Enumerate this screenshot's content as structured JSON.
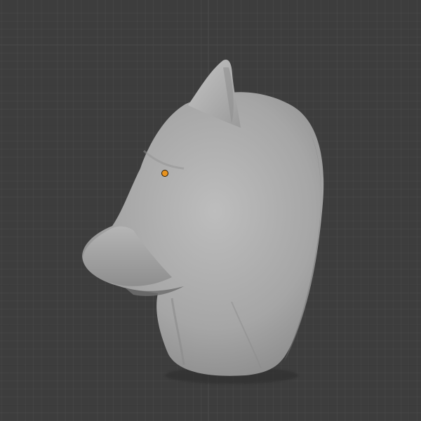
{
  "viewport": {
    "mode": "3D Viewport",
    "background_color": "#3d3d3d",
    "grid_color": "#474747"
  },
  "object": {
    "shape": "sculpted animal head mesh",
    "material_color": "#a9a9a9",
    "origin_color": "#e8931f",
    "selected": false
  }
}
